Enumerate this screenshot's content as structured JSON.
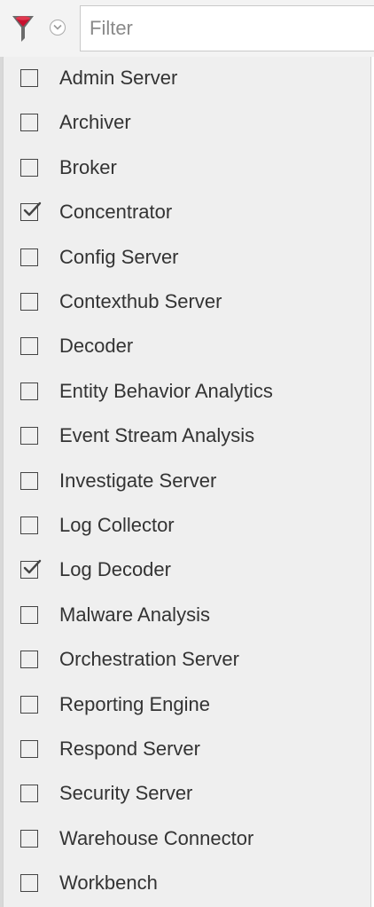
{
  "toolbar": {
    "filter_icon": "funnel-icon",
    "caret_icon": "chevron-down-icon",
    "filter_placeholder": "Filter",
    "accent_color": "#c8102e"
  },
  "options": [
    {
      "label": "Admin Server",
      "checked": false
    },
    {
      "label": "Archiver",
      "checked": false
    },
    {
      "label": "Broker",
      "checked": false
    },
    {
      "label": "Concentrator",
      "checked": true
    },
    {
      "label": "Config Server",
      "checked": false
    },
    {
      "label": "Contexthub Server",
      "checked": false
    },
    {
      "label": "Decoder",
      "checked": false
    },
    {
      "label": "Entity Behavior Analytics",
      "checked": false
    },
    {
      "label": "Event Stream Analysis",
      "checked": false
    },
    {
      "label": "Investigate Server",
      "checked": false
    },
    {
      "label": "Log Collector",
      "checked": false
    },
    {
      "label": "Log Decoder",
      "checked": true
    },
    {
      "label": "Malware Analysis",
      "checked": false
    },
    {
      "label": "Orchestration Server",
      "checked": false
    },
    {
      "label": "Reporting Engine",
      "checked": false
    },
    {
      "label": "Respond Server",
      "checked": false
    },
    {
      "label": "Security Server",
      "checked": false
    },
    {
      "label": "Warehouse Connector",
      "checked": false
    },
    {
      "label": "Workbench",
      "checked": false
    }
  ]
}
